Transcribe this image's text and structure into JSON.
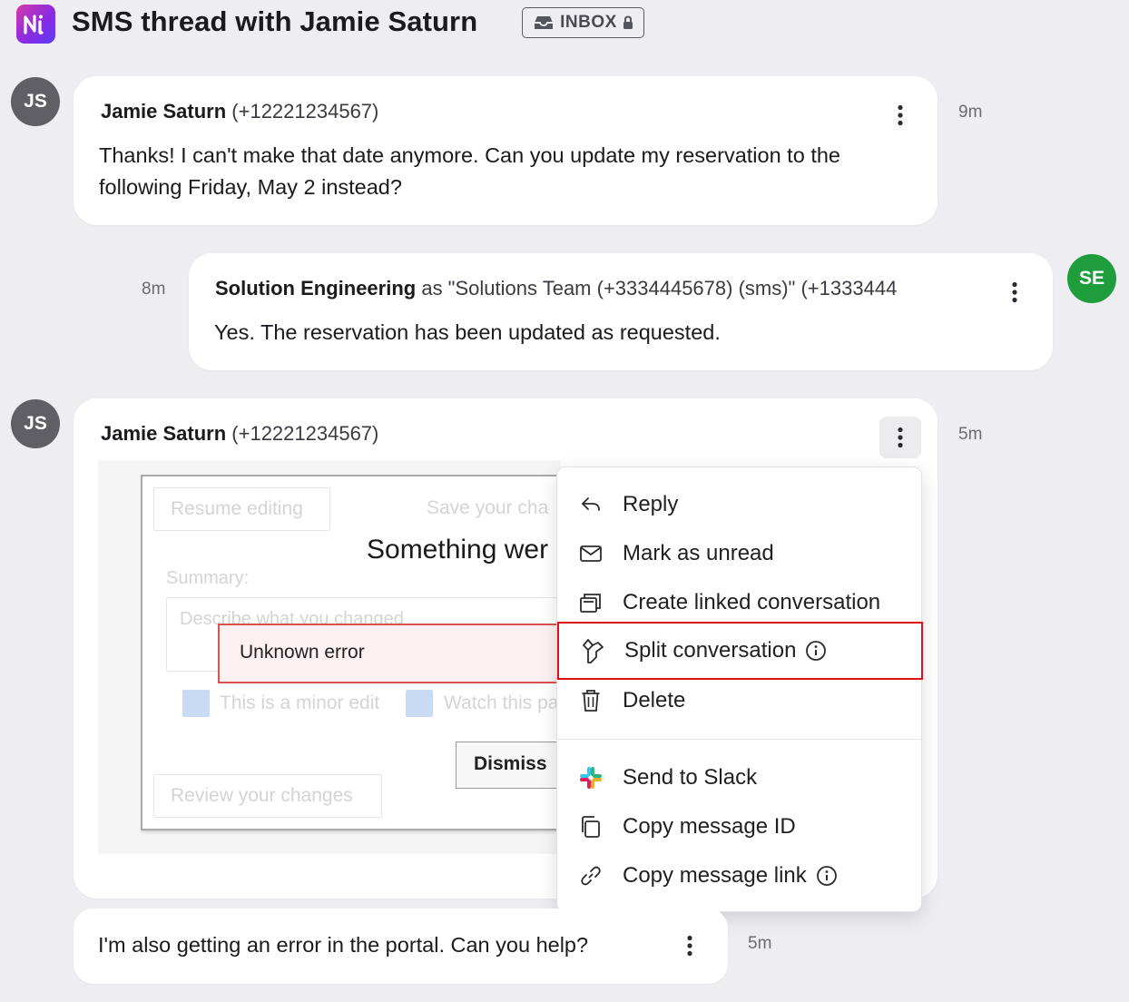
{
  "header": {
    "title": "SMS thread with Jamie Saturn",
    "badge_label": "INBOX"
  },
  "messages": [
    {
      "avatar_initials": "JS",
      "sender_name": "Jamie Saturn",
      "sender_detail": " (+12221234567)",
      "text": "Thanks! I can't make that date anymore. Can you update my reservation to the following Friday, May 2 instead?",
      "time": "9m"
    },
    {
      "avatar_initials": "SE",
      "sender_name": "Solution Engineering",
      "sender_detail": " as \"Solutions Team (+3334445678) (sms)\" (+1333444",
      "text": "Yes. The reservation has been updated as requested.",
      "time": "8m"
    },
    {
      "avatar_initials": "JS",
      "sender_name": "Jamie Saturn",
      "sender_detail": " (+12221234567)",
      "time": "5m",
      "attachment": {
        "resume_editing": "Resume editing",
        "save_changes": "Save your cha",
        "error_title": "Something wer",
        "summary_label": "Summary:",
        "summary_placeholder": "Describe what you changed",
        "error_message": "Unknown error",
        "minor_edit": "This is a minor edit",
        "watch_page": "Watch this pa",
        "dismiss": "Dismiss",
        "review_changes": "Review your changes"
      }
    },
    {
      "text": "I'm also getting an error in the portal. Can you help?",
      "time": "5m"
    }
  ],
  "context_menu": {
    "items": [
      {
        "label": "Reply",
        "icon": "reply-icon"
      },
      {
        "label": "Mark as unread",
        "icon": "envelope-icon"
      },
      {
        "label": "Create linked conversation",
        "icon": "linked-conversation-icon"
      },
      {
        "label": "Split conversation",
        "icon": "split-icon",
        "info": true,
        "highlighted": true
      },
      {
        "label": "Delete",
        "icon": "trash-icon"
      },
      {
        "label": "Send to Slack",
        "icon": "slack-icon"
      },
      {
        "label": "Copy message ID",
        "icon": "copy-icon"
      },
      {
        "label": "Copy message link",
        "icon": "link-icon",
        "info": true
      }
    ]
  },
  "colors": {
    "background": "#eeeef2",
    "highlight_border": "#e0101a",
    "agent_avatar": "#1f9c3c",
    "contact_avatar": "#5f5f65"
  }
}
